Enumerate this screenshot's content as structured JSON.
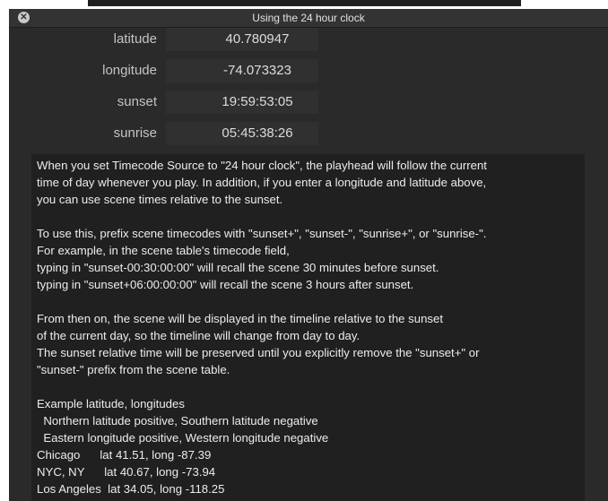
{
  "window": {
    "title": "Using the 24 hour clock"
  },
  "fields": [
    {
      "key": "latitude",
      "label": "latitude",
      "value": "40.780947"
    },
    {
      "key": "longitude",
      "label": "longitude",
      "value": "-74.073323"
    },
    {
      "key": "sunset",
      "label": "sunset",
      "value": "19:59:53:05"
    },
    {
      "key": "sunrise",
      "label": "sunrise",
      "value": "05:45:38:26"
    }
  ],
  "help": {
    "p1": [
      "When you set Timecode Source to \"24 hour clock\", the playhead will follow the current",
      "time of day whenever you play.  In addition, if you enter a longitude and latitude above,",
      "you can use scene times relative to the sunset."
    ],
    "p2": [
      "To use this, prefix scene timecodes with \"sunset+\", \"sunset-\", \"sunrise+\", or \"sunrise-\".",
      "For example, in the scene table's timecode field,",
      "typing in \"sunset-00:30:00:00\" will recall the scene 30 minutes before sunset.",
      "typing in \"sunset+06:00:00:00\" will recall the scene 3 hours after sunset."
    ],
    "p3": [
      "From then on, the scene will be displayed in the timeline relative to the sunset",
      "of the current day, so the timeline will change from day to day.",
      "The sunset relative time will be preserved until you explicitly remove the \"sunset+\" or",
      "\"sunset-\" prefix from the scene table."
    ],
    "p4": [
      "Example latitude, longitudes",
      "  Northern latitude positive, Southern latitude negative",
      "  Eastern longitude positive, Western longitude negative",
      "Chicago      lat 41.51, long -87.39",
      "NYC, NY      lat 40.67, long -73.94",
      "Los Angeles  lat 34.05, long -118.25"
    ]
  }
}
